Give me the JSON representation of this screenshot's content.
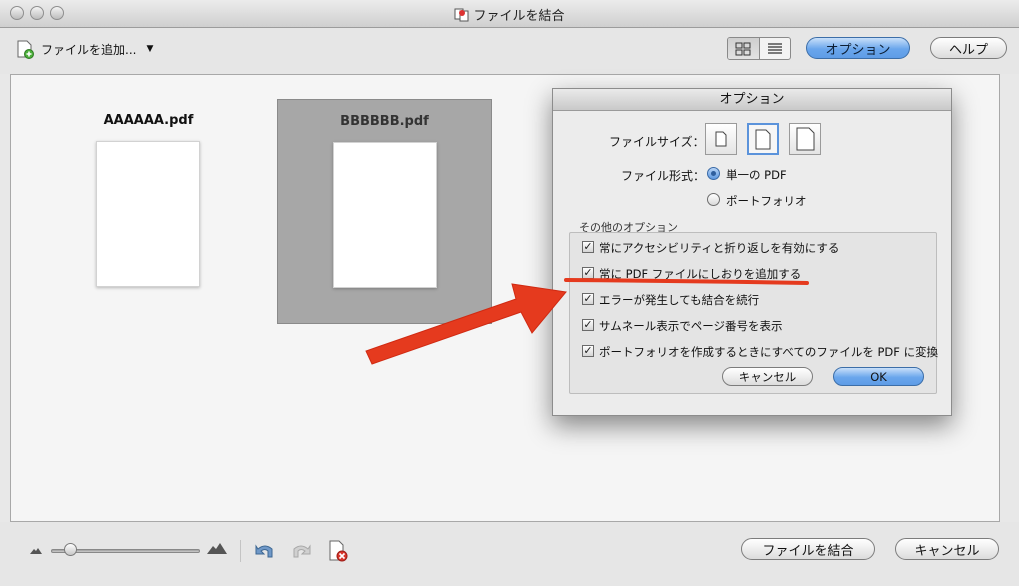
{
  "window": {
    "title": "ファイルを結合"
  },
  "toolbar": {
    "add_files_label": "ファイルを追加...",
    "options_label": "オプション",
    "help_label": "ヘルプ"
  },
  "files": [
    {
      "name": "AAAAAA.pdf",
      "selected": false
    },
    {
      "name": "BBBBBB.pdf",
      "selected": true
    }
  ],
  "options_dialog": {
    "title": "オプション",
    "file_size_label": "ファイルサイズ：",
    "file_size_selected": "medium",
    "file_format_label": "ファイル形式：",
    "format_options": [
      {
        "label": "単一の PDF",
        "checked": true
      },
      {
        "label": "ポートフォリオ",
        "checked": false
      }
    ],
    "other_options_title": "その他のオプション",
    "checkboxes": [
      {
        "label": "常にアクセシビリティと折り返しを有効にする",
        "checked": true
      },
      {
        "label": "常に PDF ファイルにしおりを追加する",
        "checked": true
      },
      {
        "label": "エラーが発生しても結合を続行",
        "checked": true
      },
      {
        "label": "サムネール表示でページ番号を表示",
        "checked": true
      },
      {
        "label": "ポートフォリオを作成するときにすべてのファイルを PDF に変換",
        "checked": true
      }
    ],
    "cancel_label": "キャンセル",
    "ok_label": "OK"
  },
  "bottom": {
    "combine_label": "ファイルを結合",
    "cancel_label": "キャンセル",
    "zoom_level": 0.1
  },
  "colors": {
    "annotation_red": "#e53a1e",
    "accent_blue": "#5e9ce6"
  }
}
